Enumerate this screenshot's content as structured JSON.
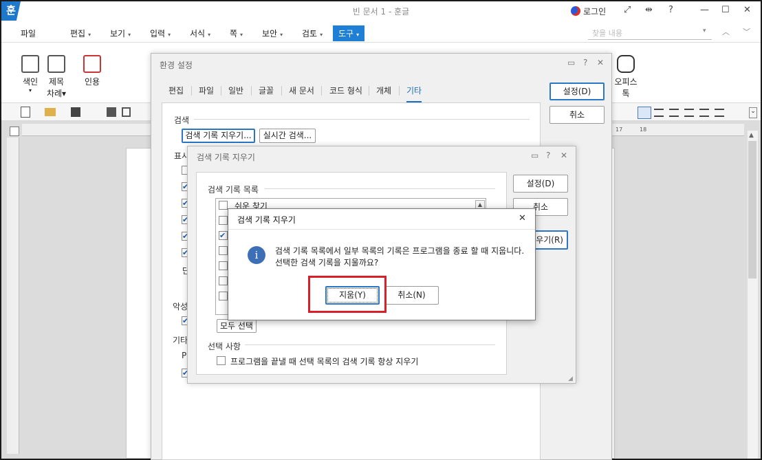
{
  "app": {
    "logo_char": "훈",
    "window_title": "빈 문서 1 - 훈글",
    "login_label": "로그인",
    "window_controls": [
      "⤢",
      "⇹",
      "?",
      "—",
      "☐",
      "✕"
    ]
  },
  "menubar": {
    "items": [
      "파일",
      "편집",
      "보기",
      "입력",
      "서식",
      "쪽",
      "보안",
      "검토",
      "도구"
    ],
    "active": "도구",
    "search_placeholder": "찾을 내용"
  },
  "ribbon": {
    "buttons": [
      {
        "label": "색인",
        "sub": "▾",
        "icon": "index-icon"
      },
      {
        "label": "제목",
        "sub": "차례▾",
        "icon": "toc-icon"
      },
      {
        "label": "인용",
        "sub": "",
        "icon": "citation-icon"
      },
      {
        "label": "오피스",
        "sub": "톡",
        "icon": "office-talk-icon"
      }
    ]
  },
  "ruler": {
    "marks": [
      "17",
      "18"
    ]
  },
  "settings_dialog": {
    "title": "환경 설정",
    "tabs": [
      "편집",
      "파일",
      "일반",
      "글꼴",
      "새 문서",
      "코드 형식",
      "개체",
      "기타"
    ],
    "active_tab": "기타",
    "ok_label": "설정(D)",
    "cancel_label": "취소",
    "search_section": "검색",
    "clear_history_button": "검색 기록 지우기...",
    "realtime_search_button": "실시간 검색...",
    "section_display": "표시",
    "section_spell": "악성",
    "section_etc": "기타",
    "row_letter_d": "단",
    "row_letter_p": "P"
  },
  "clear_history_dialog": {
    "title": "검색 기록 지우기",
    "list_section": "검색 기록 목록",
    "first_item": "쉬운 찾기",
    "select_all_button": "모두 선택",
    "ok_label": "설정(D)",
    "cancel_label": "취소",
    "delete_label": "우기(R)",
    "option_section": "선택 사항",
    "option_text": "프로그램을 끝낼 때 선택 목록의 검색 기록 항상 지우기"
  },
  "confirm_dialog": {
    "title": "검색 기록 지우기",
    "message_line1": "검색 기록 목록에서 일부 목록의 기록은 프로그램을 종료 할 때 지웁니다.",
    "message_line2": "선택한 검색 기록을 지울까요?",
    "yes_label": "지움(Y)",
    "no_label": "취소(N)",
    "close": "✕",
    "info_char": "i"
  },
  "colors": {
    "accent": "#1f7fd4",
    "highlight": "#d7202a",
    "info": "#3c6fb6"
  }
}
